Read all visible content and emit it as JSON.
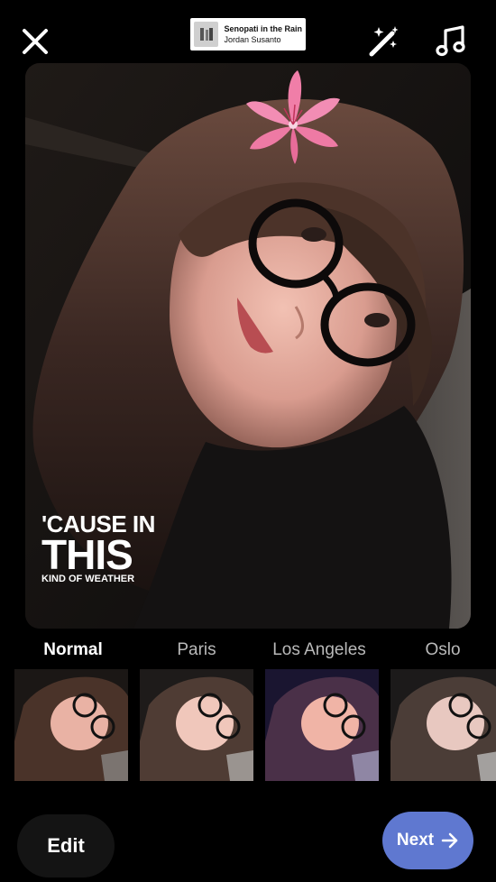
{
  "topbar": {
    "close_icon": "close-icon",
    "magic_icon": "magic-wand-icon",
    "music_icon": "music-note-icon"
  },
  "music_sticker": {
    "song": "Senopati in the Rain",
    "artist": "Jordan Susanto"
  },
  "lyrics": {
    "line1": "'CAUSE IN",
    "line2": "THIS",
    "line3": "KIND OF WEATHER"
  },
  "filters": [
    {
      "label": "Normal",
      "active": true
    },
    {
      "label": "Paris",
      "active": false
    },
    {
      "label": "Los Angeles",
      "active": false
    },
    {
      "label": "Oslo",
      "active": false
    }
  ],
  "bottom": {
    "edit_label": "Edit",
    "next_label": "Next"
  },
  "colors": {
    "next_button": "#5f78d0",
    "background": "#000000"
  }
}
